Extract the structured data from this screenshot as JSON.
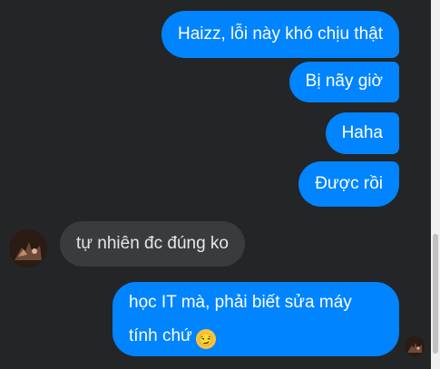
{
  "messages": [
    {
      "direction": "outgoing",
      "text": "Haizz, lỗi này khó chịu thật"
    },
    {
      "direction": "outgoing",
      "text": "Bị nãy giờ"
    },
    {
      "direction": "outgoing",
      "text": "Haha"
    },
    {
      "direction": "outgoing",
      "text": "Được rồi"
    },
    {
      "direction": "incoming",
      "text": "tự nhiên đc đúng ko"
    },
    {
      "direction": "outgoing",
      "text": "học IT mà, phải biết sửa máy tính chứ",
      "emoji": "smirk-emoji"
    }
  ],
  "colors": {
    "background": "#242526",
    "outgoing_bubble": "#0084ff",
    "incoming_bubble": "#3a3b3c"
  }
}
